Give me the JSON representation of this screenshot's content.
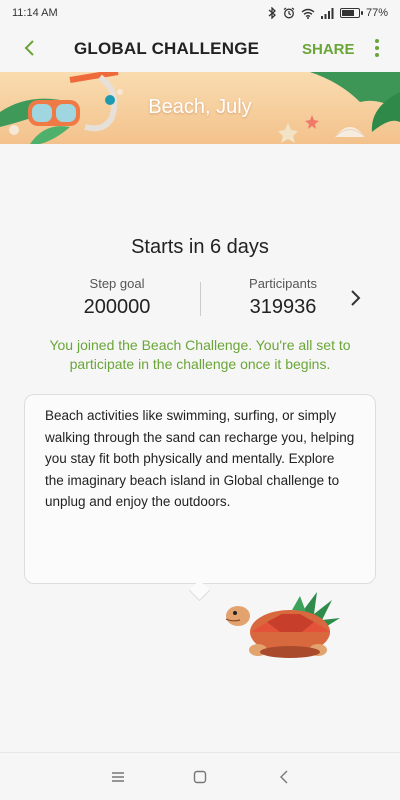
{
  "status": {
    "time": "11:14 AM",
    "battery": "77%",
    "battery_level": 0.77
  },
  "appbar": {
    "title": "GLOBAL CHALLENGE",
    "share_label": "SHARE"
  },
  "banner": {
    "title": "Beach, July"
  },
  "challenge": {
    "starts": "Starts in 6 days",
    "step_goal_label": "Step goal",
    "step_goal_value": "200000",
    "participants_label": "Participants",
    "participants_value": "319936",
    "joined_message": "You joined the Beach Challenge. You're all set to participate in the challenge once it begins."
  },
  "description": "Beach activities like swimming, surfing, or simply walking through the sand can recharge you, helping you stay fit both physically and mentally. Explore the imaginary beach island in Global challenge to unplug and enjoy the outdoors.",
  "colors": {
    "accent": "#6aa637",
    "banner": "#f3c28c"
  },
  "icons": [
    "bluetooth-icon",
    "alarm-icon",
    "wifi-icon",
    "signal-icon",
    "battery-icon",
    "back-arrow-icon",
    "more-vert-icon",
    "chevron-right-icon",
    "menu-icon",
    "home-icon",
    "back-nav-icon",
    "turtle-icon"
  ]
}
